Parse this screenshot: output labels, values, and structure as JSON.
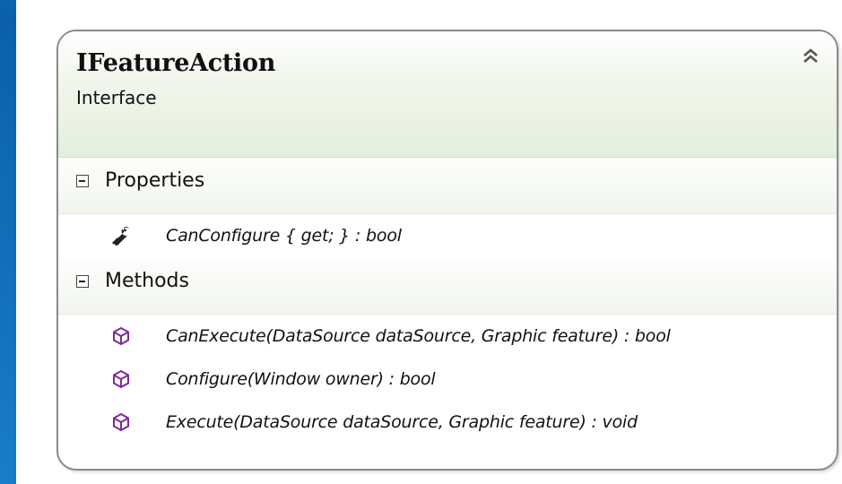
{
  "class": {
    "name": "IFeatureAction",
    "stereotype": "Interface"
  },
  "icons": {
    "collapse": "double-chevron-up-icon",
    "property": "wrench-icon",
    "method": "method-cube-icon",
    "section_toggle": "minus-box-icon"
  },
  "colors": {
    "header_green": "#e4efdb",
    "method_icon": "#7b2a9c",
    "background_blue": "#0b62ad"
  },
  "sections": {
    "properties": {
      "label": "Properties",
      "items": [
        "CanConfigure { get; } : bool"
      ]
    },
    "methods": {
      "label": "Methods",
      "items": [
        "CanExecute(DataSource dataSource, Graphic feature) : bool",
        "Configure(Window owner) : bool",
        "Execute(DataSource dataSource, Graphic feature) : void"
      ]
    }
  }
}
